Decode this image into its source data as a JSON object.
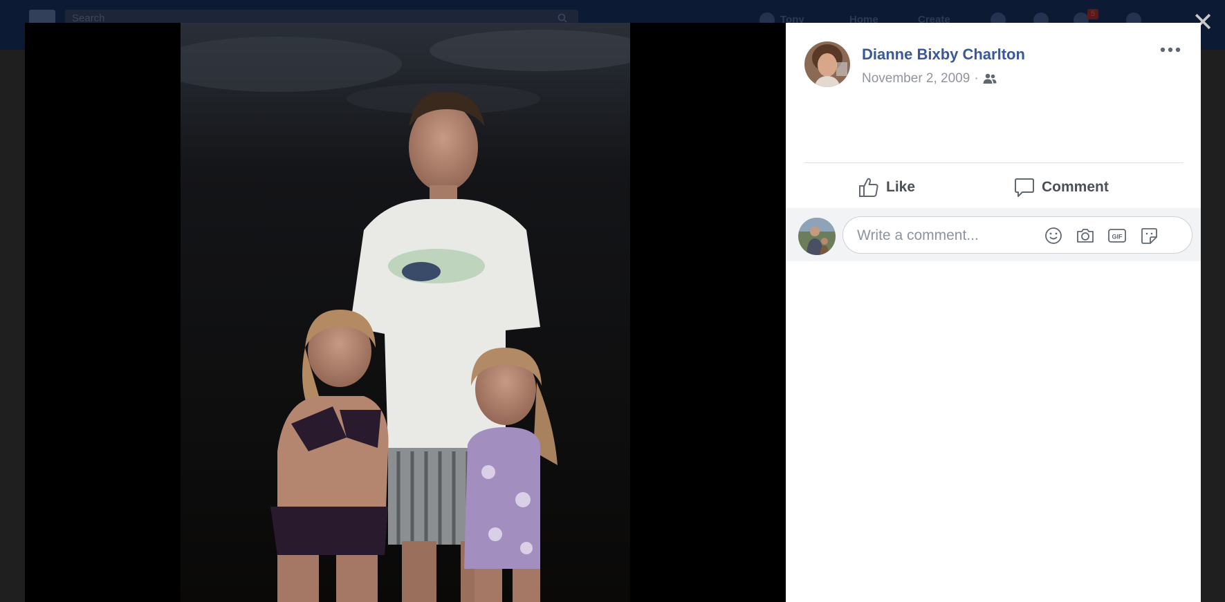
{
  "topbar": {
    "search_placeholder": "Search",
    "nav": [
      "Tony",
      "Home",
      "Create"
    ],
    "notification_count": "5"
  },
  "close_icon": "close-icon",
  "post": {
    "author": "Dianne Bixby Charlton",
    "date": "November 2, 2009",
    "separator": "·",
    "privacy_icon": "friends-icon",
    "more_icon": "more-options-icon"
  },
  "actions": {
    "like_label": "Like",
    "comment_label": "Comment"
  },
  "comment": {
    "placeholder": "Write a comment...",
    "icons": [
      "emoji-icon",
      "camera-icon",
      "gif-icon",
      "sticker-icon"
    ]
  },
  "colors": {
    "author_link": "#385898",
    "meta_text": "#90949c",
    "action_text": "#4b4f56"
  }
}
